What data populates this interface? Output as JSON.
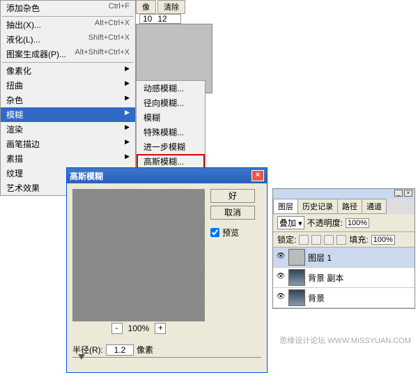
{
  "menu": {
    "add_noise": "添加杂色",
    "add_noise_sc": "Ctrl+F",
    "extract": "抽出(X)...",
    "extract_sc": "Alt+Ctrl+X",
    "liquify": "液化(L)...",
    "liquify_sc": "Shift+Ctrl+X",
    "pattern": "图案生成器(P)...",
    "pattern_sc": "Alt+Shift+Ctrl+X",
    "pixelate": "像素化",
    "distort": "扭曲",
    "noise": "杂色",
    "blur": "模糊",
    "render": "渲染",
    "brush": "画笔描边",
    "sketch": "素描",
    "texture": "纹理",
    "artistic": "艺术效果"
  },
  "toolbar": {
    "btn1": "像",
    "btn2": "清除"
  },
  "ruler": {
    "t1": "10",
    "t2": "12"
  },
  "submenu": {
    "motion": "动感模糊...",
    "radial": "径向模糊...",
    "blur": "模糊",
    "special": "特殊模糊...",
    "more": "进一步模糊",
    "gaussian": "高斯模糊..."
  },
  "dialog": {
    "title": "高斯模糊",
    "ok": "好",
    "cancel": "取消",
    "preview": "预览",
    "zoom": "100%",
    "radius_lbl": "半径(R):",
    "radius_val": "1.2",
    "pixel": "像素"
  },
  "layers": {
    "tab1": "图层",
    "tab2": "历史记录",
    "tab3": "路径",
    "tab4": "通道",
    "blend": "叠加",
    "opacity_lbl": "不透明度:",
    "opacity": "100%",
    "lock": "锁定:",
    "fill_lbl": "填充:",
    "fill": "100%",
    "l1": "图层 1",
    "l2": "背景 副本",
    "l3": "背景"
  },
  "watermark": "思缘设计论坛 WWW.MISSYUAN.COM"
}
